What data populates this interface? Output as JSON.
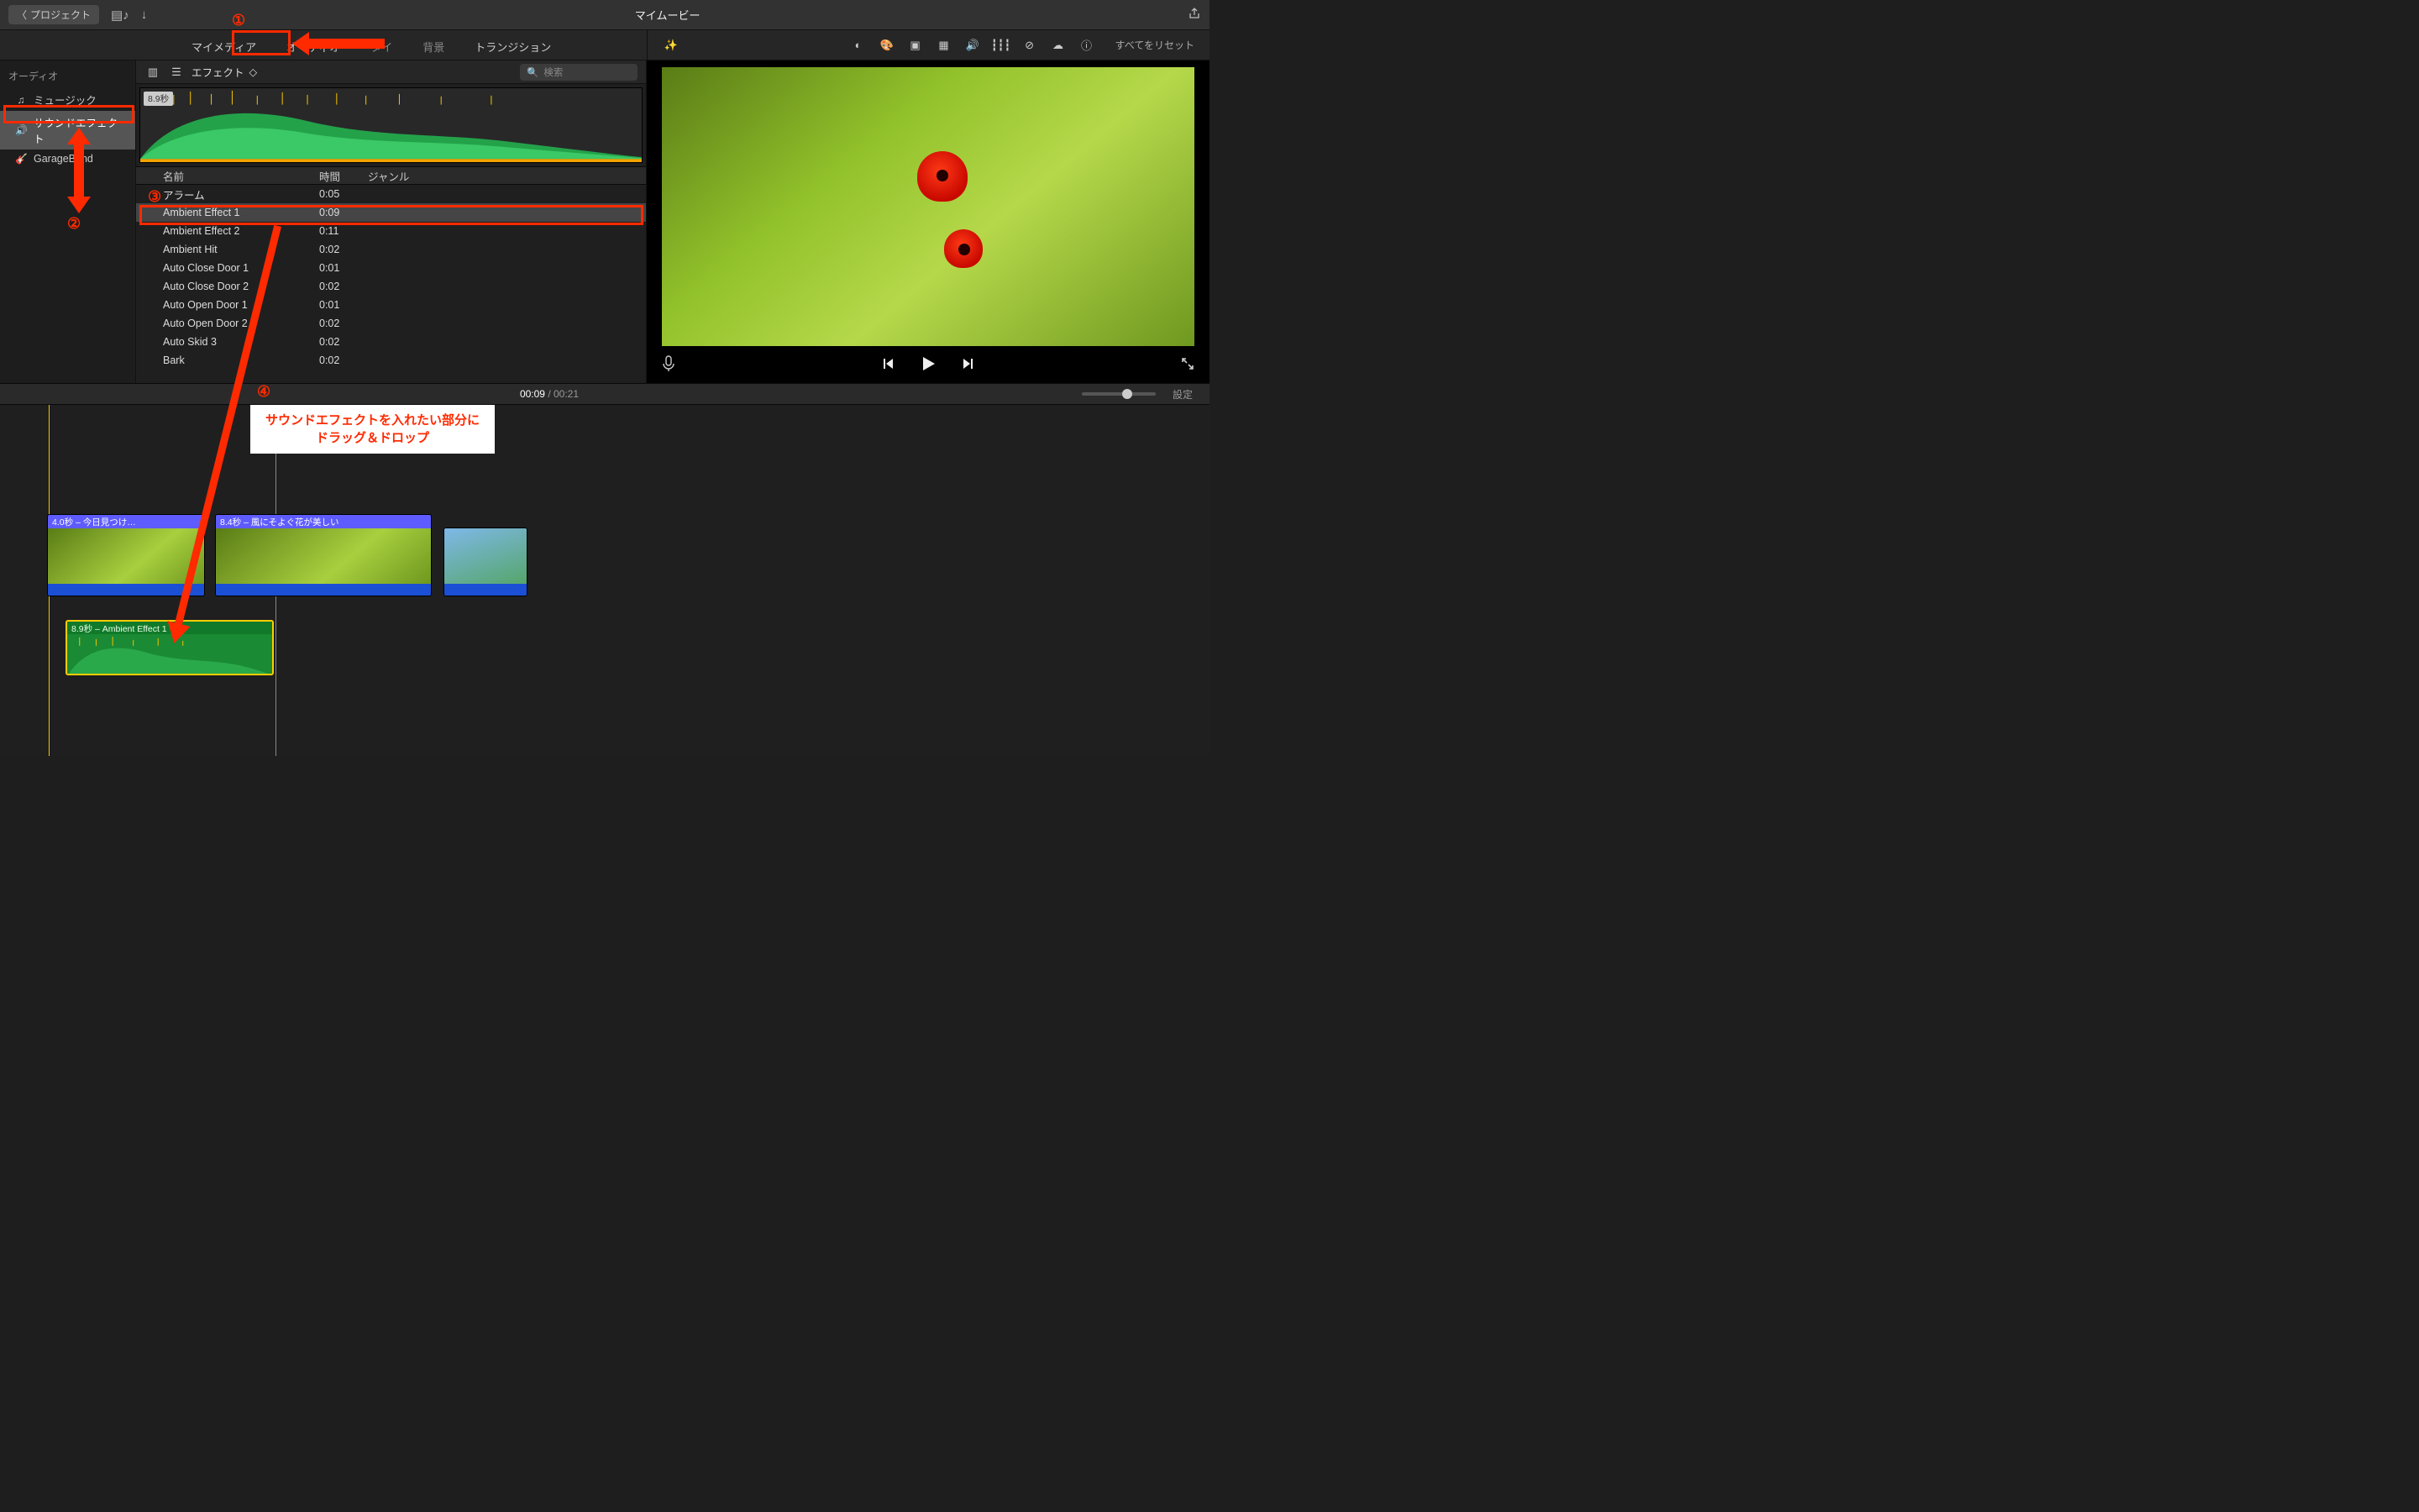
{
  "titlebar": {
    "back": "プロジェクト",
    "title": "マイムービー"
  },
  "tabs": {
    "mymedia": "マイメディア",
    "audio": "オーディオ",
    "titles": "タイ",
    "background": "背景",
    "transitions": "トランジション",
    "reset_all": "すべてをリセット"
  },
  "sidebar": {
    "header": "オーディオ",
    "items": [
      {
        "icon": "♫",
        "label": "ミュージック"
      },
      {
        "icon": "🔊",
        "label": "サウンドエフェクト"
      },
      {
        "icon": "🎸",
        "label": "GarageBand"
      }
    ]
  },
  "library": {
    "popup": "エフェクト",
    "search_placeholder": "検索",
    "preview_duration": "8.9秒",
    "columns": {
      "name": "名前",
      "time": "時間",
      "genre": "ジャンル"
    },
    "rows": [
      {
        "name": "アラーム",
        "time": "0:05"
      },
      {
        "name": "Ambient Effect 1",
        "time": "0:09"
      },
      {
        "name": "Ambient Effect 2",
        "time": "0:11"
      },
      {
        "name": "Ambient Hit",
        "time": "0:02"
      },
      {
        "name": "Auto Close Door 1",
        "time": "0:01"
      },
      {
        "name": "Auto Close Door 2",
        "time": "0:02"
      },
      {
        "name": "Auto Open Door 1",
        "time": "0:01"
      },
      {
        "name": "Auto Open Door 2",
        "time": "0:02"
      },
      {
        "name": "Auto Skid 3",
        "time": "0:02"
      },
      {
        "name": "Bark",
        "time": "0:02"
      }
    ],
    "selected_index": 1
  },
  "timecode": {
    "current": "00:09",
    "total": "00:21"
  },
  "settings_label": "設定",
  "timeline": {
    "clips": [
      {
        "label": "4.0秒 – 今日見つけ…"
      },
      {
        "label": "8.4秒 – 風にそよぐ花が美しい"
      },
      {
        "label": ""
      }
    ],
    "audio_clip": {
      "label": "8.9秒 – Ambient Effect 1"
    }
  },
  "annotations": {
    "n1": "①",
    "n2": "②",
    "n3": "③",
    "n4": "④",
    "callout_l1": "サウンドエフェクトを入れたい部分に",
    "callout_l2": "ドラッグ＆ドロップ"
  }
}
